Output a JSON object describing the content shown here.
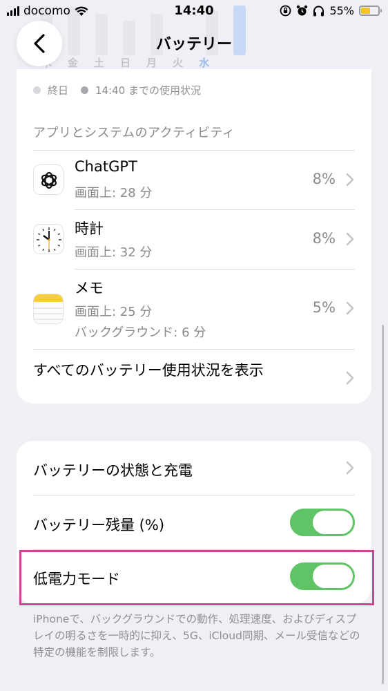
{
  "status_bar": {
    "carrier": "docomo",
    "time": "14:40",
    "battery_percent": "55%",
    "battery_level": 0.55,
    "icons": [
      "signal-icon",
      "wifi-icon",
      "rotation-lock-icon",
      "alarm-icon",
      "headphones-icon",
      "battery-icon"
    ]
  },
  "nav": {
    "title": "バッテリー",
    "back_icon": "chevron-left-icon"
  },
  "chart_days": [
    "木",
    "金",
    "土",
    "日",
    "月",
    "火",
    "水"
  ],
  "legend": {
    "all_day": "終日",
    "until_now": "14:40 までの使用状況"
  },
  "activity": {
    "header": "アプリとシステムのアクティビティ",
    "apps": [
      {
        "name": "ChatGPT",
        "screen": "画面上: 28 分",
        "background": "",
        "percent": "8%",
        "icon": "chatgpt-icon"
      },
      {
        "name": "時計",
        "screen": "画面上: 32 分",
        "background": "",
        "percent": "8%",
        "icon": "clock-icon"
      },
      {
        "name": "メモ",
        "screen": "画面上: 25 分",
        "background": "バックグラウンド: 6 分",
        "percent": "5%",
        "icon": "notes-icon"
      }
    ],
    "show_all": "すべてのバッテリー使用状況を表示"
  },
  "settings": {
    "health_label": "バッテリーの状態と充電",
    "percentage_label": "バッテリー残量 (%)",
    "percentage_on": true,
    "low_power_label": "低電力モード",
    "low_power_on": true
  },
  "footnote": "iPhoneで、バックグラウンドでの動作、処理速度、およびディスプレイの明るさを一時的に抑え、5G、iCloud同期、メール受信などの特定の機能を制限します。",
  "colors": {
    "toggle_on": "#5fc465",
    "highlight": "#c9478e",
    "battery": "#f5c518"
  }
}
